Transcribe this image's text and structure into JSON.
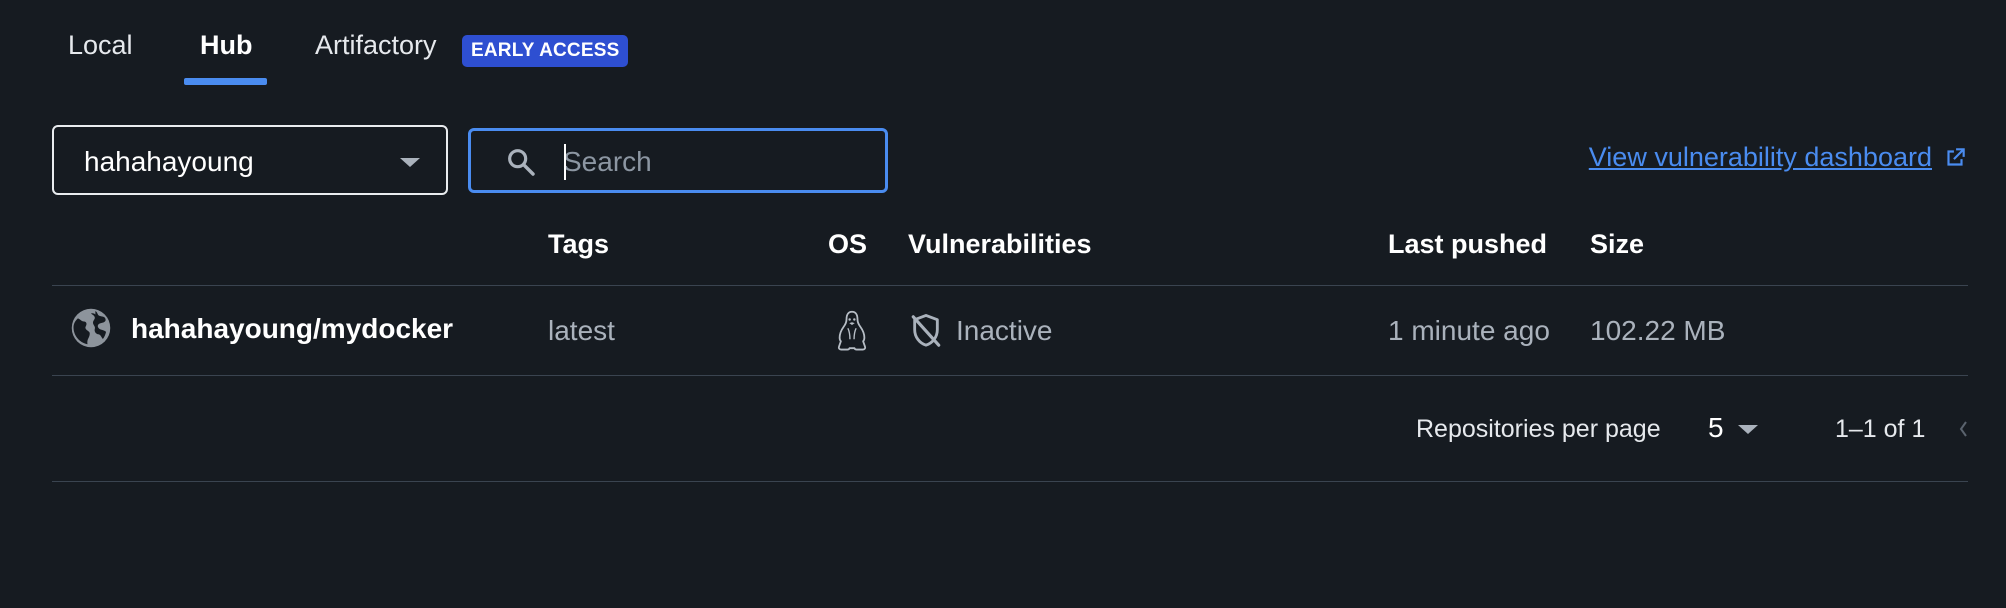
{
  "tabs": [
    {
      "label": "Local",
      "active": false
    },
    {
      "label": "Hub",
      "active": true
    },
    {
      "label": "Artifactory",
      "active": false
    }
  ],
  "badge": {
    "label": "EARLY ACCESS",
    "color": "#2e4fd1"
  },
  "namespace_select": {
    "value": "hahahayoung"
  },
  "search": {
    "placeholder": "Search",
    "value": ""
  },
  "vuln_link": {
    "label": "View vulnerability dashboard",
    "icon": "external-link-icon"
  },
  "table": {
    "headers": {
      "tags": "Tags",
      "os": "OS",
      "vulnerabilities": "Vulnerabilities",
      "last_pushed": "Last pushed",
      "size": "Size"
    },
    "rows": [
      {
        "icon": "globe-icon",
        "name": "hahahayoung/mydocker",
        "tag": "latest",
        "os_icon": "linux-icon",
        "vulnerability_icon": "shield-off-icon",
        "vulnerabilities": "Inactive",
        "last_pushed": "1 minute ago",
        "size": "102.22 MB"
      }
    ]
  },
  "pagination": {
    "label": "Repositories per page",
    "per_page": "5",
    "range": "1–1 of 1"
  },
  "colors": {
    "background": "#161b21",
    "accent": "#4a8cf0",
    "divider": "#3a4450",
    "muted_text": "#aab2bc"
  }
}
